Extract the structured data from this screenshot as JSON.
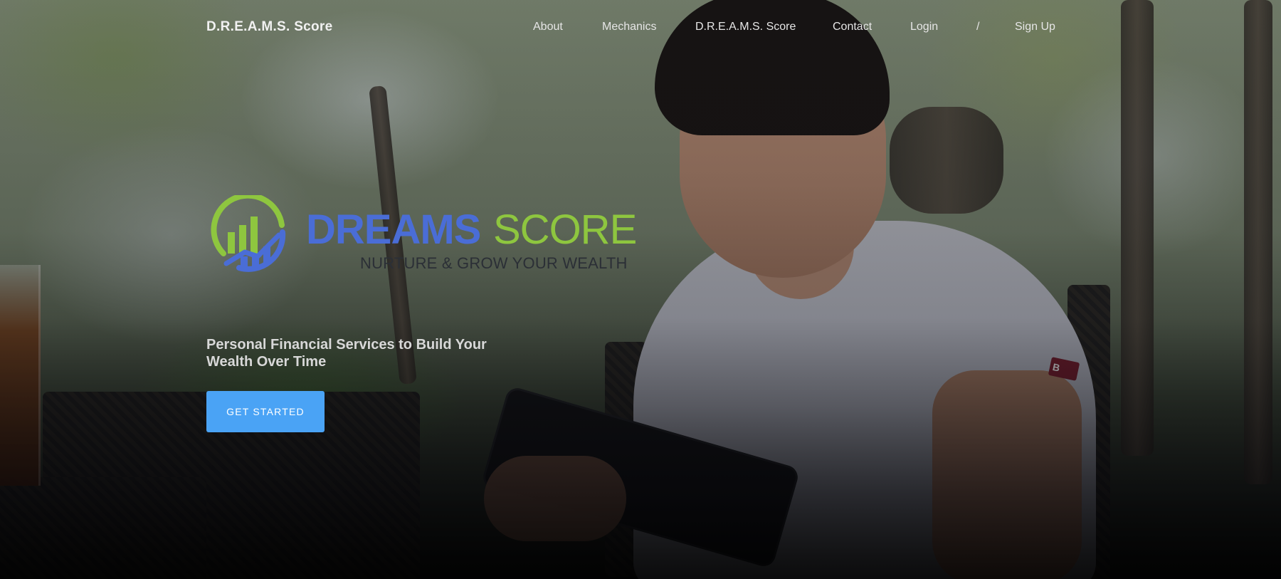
{
  "nav": {
    "brand": "D.R.E.A.M.S. Score",
    "links": [
      {
        "label": "About"
      },
      {
        "label": "Mechanics"
      },
      {
        "label": "D.R.E.A.M.S. Score"
      },
      {
        "label": "Contact"
      },
      {
        "label": "Login"
      },
      {
        "label": "/"
      },
      {
        "label": "Sign Up"
      }
    ]
  },
  "logo": {
    "word_primary": "DREAMS",
    "word_secondary": "SCORE",
    "tagline": "NURTURE & GROW YOUR WEALTH",
    "colors": {
      "blue": "#4a6dd6",
      "green": "#8ec63f"
    },
    "icon": "growth-chart-circle-icon"
  },
  "hero": {
    "subtitle": "Personal Financial Services to Build Your Wealth Over Time",
    "cta_label": "GET STARTED",
    "cta_color": "#4aa3f5"
  }
}
